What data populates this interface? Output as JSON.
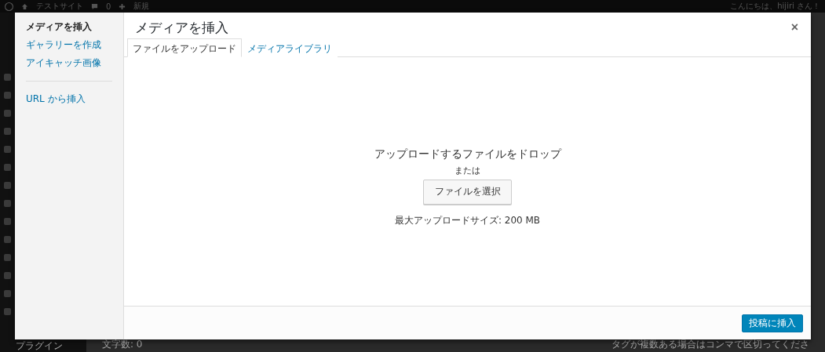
{
  "admin_bar": {
    "site_name": "テストサイト",
    "comments_count": "0",
    "new_label": "新規",
    "greeting": "こんにちは、hijiri さん！"
  },
  "admin_menu": {
    "items": [
      {
        "label": "プラグイン"
      }
    ]
  },
  "page_behind": {
    "word_count": "文字数: 0",
    "tag_hint": "タグが複数ある場合はコンマで区切ってくださ"
  },
  "modal": {
    "title": "メディアを挿入",
    "close": "×",
    "sidebar": {
      "groups": [
        [
          {
            "label": "メディアを挿入",
            "selected": true
          },
          {
            "label": "ギャラリーを作成",
            "selected": false
          },
          {
            "label": "アイキャッチ画像",
            "selected": false
          }
        ],
        [
          {
            "label": "URL から挿入",
            "selected": false
          }
        ]
      ]
    },
    "tabs": [
      {
        "label": "ファイルをアップロード",
        "selected": true
      },
      {
        "label": "メディアライブラリ",
        "selected": false
      }
    ],
    "uploader": {
      "heading": "アップロードするファイルをドロップ",
      "or": "または",
      "select_button": "ファイルを選択",
      "max_size": "最大アップロードサイズ: 200 MB"
    },
    "footer": {
      "insert_button": "投稿に挿入"
    }
  }
}
